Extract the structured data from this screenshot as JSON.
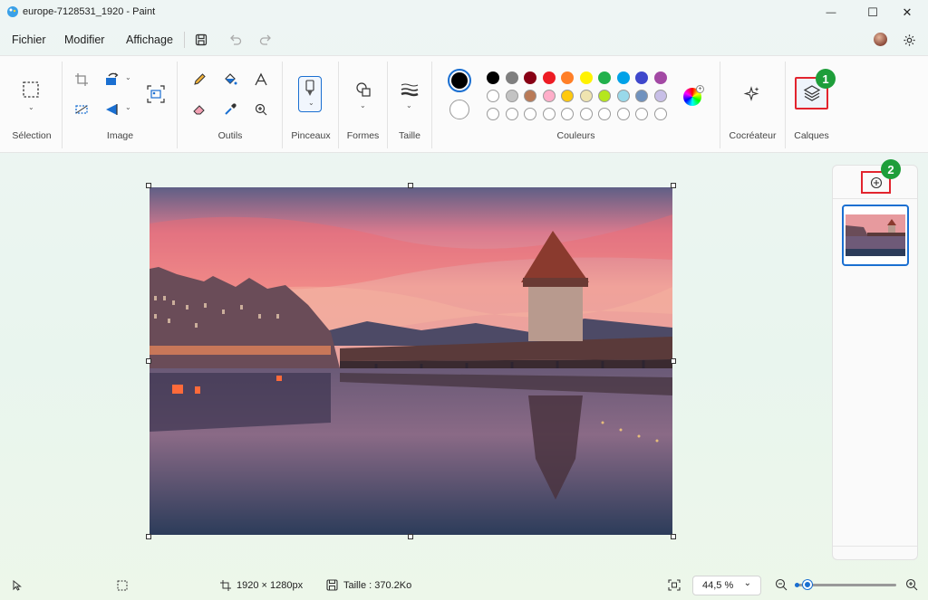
{
  "window": {
    "title": "europe-7128531_1920 - Paint",
    "minimize": "—",
    "maximize": "☐",
    "close": "✕"
  },
  "menu": {
    "items": [
      "Fichier",
      "Modifier",
      "Affichage"
    ]
  },
  "ribbon": {
    "groups": {
      "selection": "Sélection",
      "image": "Image",
      "tools": "Outils",
      "brushes": "Pinceaux",
      "shapes": "Formes",
      "size": "Taille",
      "colors": "Couleurs",
      "cocreator": "Cocréateur",
      "layers": "Calques"
    },
    "primary_color": "#000000",
    "secondary_color": "#ffffff",
    "palette_row1": [
      "#000000",
      "#7f7f7f",
      "#880015",
      "#ed1c24",
      "#ff7f27",
      "#fff200",
      "#22b14c",
      "#00a2e8",
      "#3f48cc",
      "#a349a4"
    ],
    "palette_row2": [
      "#ffffff",
      "#c3c3c3",
      "#b97a57",
      "#ffaec9",
      "#ffc90e",
      "#efe4b0",
      "#b5e61d",
      "#99d9ea",
      "#7092be",
      "#c8bfe7"
    ],
    "empty_slots": 10
  },
  "callouts": [
    "1",
    "2"
  ],
  "status": {
    "dimensions": "1920 × 1280px",
    "size": "Taille : 370.2Ko",
    "zoom": "44,5 %"
  },
  "accent": "#1a6fd1"
}
